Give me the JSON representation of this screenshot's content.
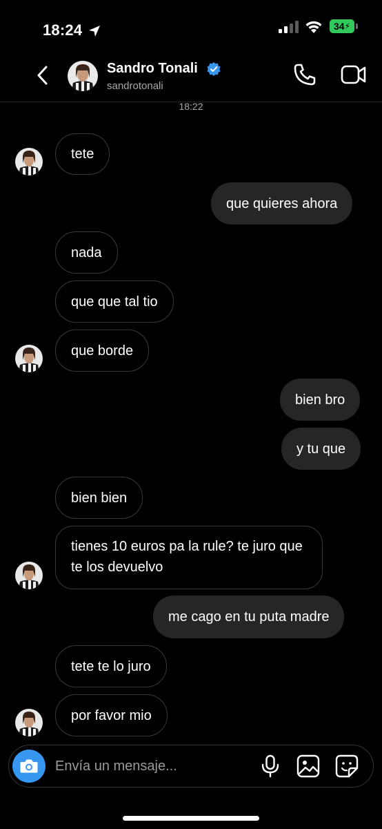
{
  "status_bar": {
    "time": "18:24",
    "battery": "34",
    "battery_color": "#31c95b"
  },
  "header": {
    "name": "Sandro Tonali",
    "username": "sandrotonali",
    "verified": true,
    "icons": [
      "back-chevron-icon",
      "verified-badge-icon",
      "phone-icon",
      "video-camera-icon"
    ]
  },
  "chat": {
    "timestamp": "18:22",
    "messages": [
      {
        "from": "them",
        "text": "tete"
      },
      {
        "from": "me",
        "text": "que quieres ahora"
      },
      {
        "from": "them",
        "text": "nada"
      },
      {
        "from": "them",
        "text": "que que tal tio"
      },
      {
        "from": "them",
        "text": "que borde"
      },
      {
        "from": "me",
        "text": "bien bro"
      },
      {
        "from": "me",
        "text": "y tu que"
      },
      {
        "from": "them",
        "text": "bien bien"
      },
      {
        "from": "them",
        "text": "tienes 10 euros pa la rule? te juro que te los devuelvo"
      },
      {
        "from": "me",
        "text": "me cago en tu puta madre"
      },
      {
        "from": "them",
        "text": "tete te lo juro"
      },
      {
        "from": "them",
        "text": "por favor mio"
      }
    ]
  },
  "composer": {
    "placeholder": "Envía un mensaje...",
    "accent_color": "#3797f0",
    "icons": [
      "camera-icon",
      "microphone-icon",
      "gallery-icon",
      "sticker-icon"
    ]
  },
  "colors": {
    "background": "#000000",
    "outgoing_bubble": "#262626",
    "incoming_border": "#3a3a3a",
    "verified_blue": "#3797f0"
  }
}
